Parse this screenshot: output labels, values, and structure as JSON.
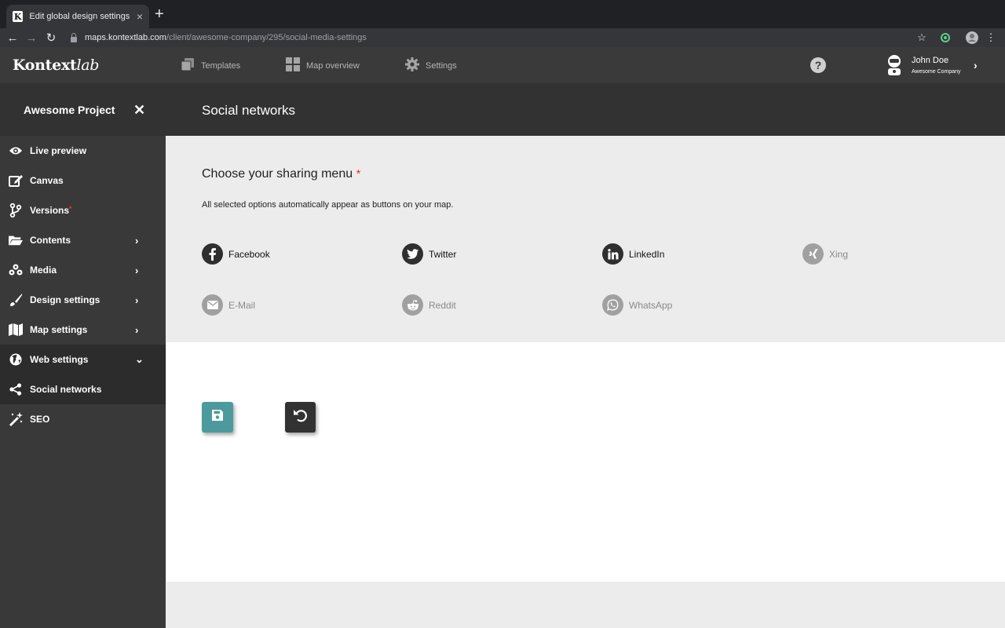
{
  "browser": {
    "tab_title": "Edit global design settings – Awesome Project",
    "tab_favicon": "K",
    "url_host": "maps.kontextlab.com",
    "url_path": "/client/awesome-company/295/social-media-settings"
  },
  "header": {
    "logo_bold": "Kontext",
    "logo_italic": "lab",
    "nav": [
      {
        "label": "Templates",
        "icon": "templates-icon"
      },
      {
        "label": "Map overview",
        "icon": "grid-icon"
      },
      {
        "label": "Settings",
        "icon": "gear-icon"
      }
    ],
    "help_label": "?",
    "user_name": "John Doe",
    "user_company": "Awesome Company"
  },
  "subheader": {
    "project_title": "Awesome Project",
    "close_label": "✕",
    "page_title": "Social networks"
  },
  "sidebar": {
    "items": [
      {
        "label": "Live preview",
        "icon": "eye-icon"
      },
      {
        "label": "Canvas",
        "icon": "edit-icon"
      },
      {
        "label": "Versions",
        "icon": "branch-icon",
        "required_mark": "*"
      },
      {
        "label": "Contents",
        "icon": "folder-icon",
        "chevron": "›"
      },
      {
        "label": "Media",
        "icon": "media-icon",
        "chevron": "›"
      },
      {
        "label": "Design settings",
        "icon": "brush-icon",
        "chevron": "›"
      },
      {
        "label": "Map settings",
        "icon": "map-icon",
        "chevron": "›"
      },
      {
        "label": "Web settings",
        "icon": "globe-icon",
        "chevron": "⌄"
      },
      {
        "label": "Social networks",
        "icon": "share-icon"
      },
      {
        "label": "SEO",
        "icon": "magic-wand-icon"
      }
    ]
  },
  "sharing": {
    "title": "Choose your sharing menu",
    "required_mark": "*",
    "description": "All selected options automatically appear as buttons on your map.",
    "options": [
      {
        "label": "Facebook",
        "selected": true,
        "icon": "facebook-icon"
      },
      {
        "label": "Twitter",
        "selected": true,
        "icon": "twitter-icon"
      },
      {
        "label": "LinkedIn",
        "selected": true,
        "icon": "linkedin-icon"
      },
      {
        "label": "Xing",
        "selected": false,
        "icon": "xing-icon"
      },
      {
        "label": "E-Mail",
        "selected": false,
        "icon": "mail-icon"
      },
      {
        "label": "Reddit",
        "selected": false,
        "icon": "reddit-icon"
      },
      {
        "label": "WhatsApp",
        "selected": false,
        "icon": "whatsapp-icon"
      }
    ]
  },
  "actions": {
    "save_icon": "save-icon",
    "undo_icon": "undo-icon"
  },
  "colors": {
    "accent_teal": "#4d9a9e",
    "required_red": "#e53935",
    "sidebar_bg": "#393939",
    "header_bg": "#3a3a3a"
  }
}
